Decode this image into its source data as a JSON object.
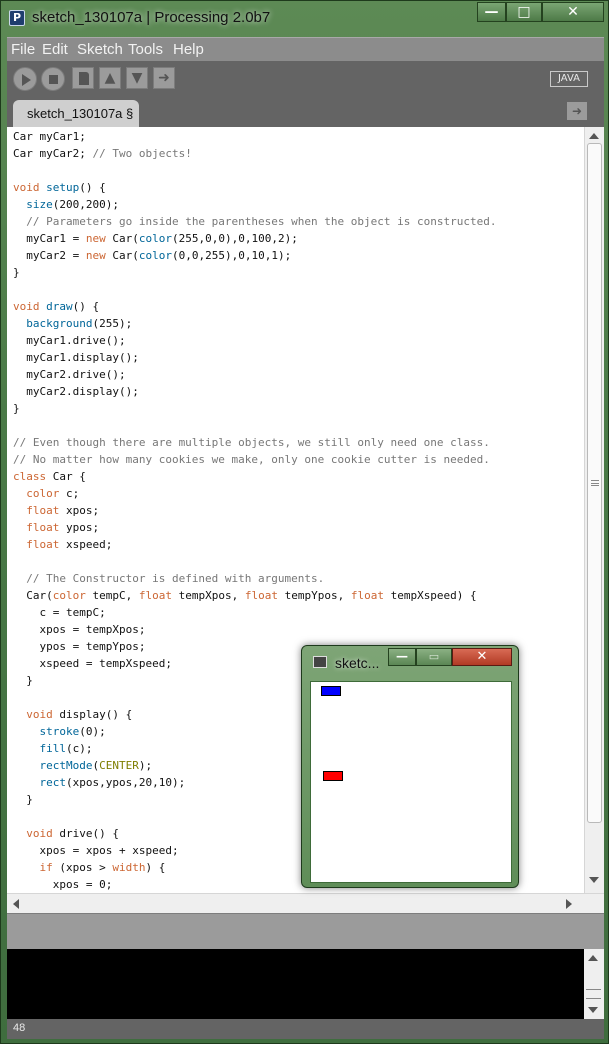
{
  "window": {
    "title": "sketch_130107a | Processing 2.0b7",
    "icon_letter": "P",
    "controls": {
      "minimize": "—",
      "maximize": "□",
      "close": "✕"
    }
  },
  "menu": {
    "items": [
      "File",
      "Edit",
      "Sketch",
      "Tools",
      "Help"
    ]
  },
  "toolbar": {
    "buttons": [
      "run-icon",
      "stop-icon",
      "new-icon",
      "open-icon",
      "save-icon",
      "export-icon"
    ],
    "mode": "JAVA"
  },
  "tabs": [
    {
      "label": "sketch_130107a §"
    }
  ],
  "tab_menu_icon": "arrow-right-icon",
  "code": {
    "lines": [
      [
        [
          "",
          "Car myCar1;"
        ]
      ],
      [
        [
          "",
          "Car myCar2; "
        ],
        [
          "cm",
          "// Two objects!"
        ]
      ],
      [
        [
          "",
          ""
        ]
      ],
      [
        [
          "kw",
          "void"
        ],
        [
          "",
          " "
        ],
        [
          "fn",
          "setup"
        ],
        [
          "",
          "() {"
        ]
      ],
      [
        [
          "",
          "  "
        ],
        [
          "fn",
          "size"
        ],
        [
          "",
          "(200,200);"
        ]
      ],
      [
        [
          "",
          "  "
        ],
        [
          "cm",
          "// Parameters go inside the parentheses when the object is constructed."
        ]
      ],
      [
        [
          "",
          "  myCar1 = "
        ],
        [
          "kw",
          "new"
        ],
        [
          "",
          " Car("
        ],
        [
          "fn",
          "color"
        ],
        [
          "",
          "(255,0,0),0,100,2);"
        ]
      ],
      [
        [
          "",
          "  myCar2 = "
        ],
        [
          "kw",
          "new"
        ],
        [
          "",
          " Car("
        ],
        [
          "fn",
          "color"
        ],
        [
          "",
          "(0,0,255),0,10,1);"
        ]
      ],
      [
        [
          "",
          "}"
        ]
      ],
      [
        [
          "",
          ""
        ]
      ],
      [
        [
          "kw",
          "void"
        ],
        [
          "",
          " "
        ],
        [
          "fn",
          "draw"
        ],
        [
          "",
          "() {"
        ]
      ],
      [
        [
          "",
          "  "
        ],
        [
          "fn",
          "background"
        ],
        [
          "",
          "(255);"
        ]
      ],
      [
        [
          "",
          "  myCar1.drive();"
        ]
      ],
      [
        [
          "",
          "  myCar1.display();"
        ]
      ],
      [
        [
          "",
          "  myCar2.drive();"
        ]
      ],
      [
        [
          "",
          "  myCar2.display();"
        ]
      ],
      [
        [
          "",
          "}"
        ]
      ],
      [
        [
          "",
          ""
        ]
      ],
      [
        [
          "cm",
          "// Even though there are multiple objects, we still only need one class."
        ]
      ],
      [
        [
          "cm",
          "// No matter how many cookies we make, only one cookie cutter is needed."
        ]
      ],
      [
        [
          "kw",
          "class"
        ],
        [
          "",
          " Car {"
        ]
      ],
      [
        [
          "",
          "  "
        ],
        [
          "kw",
          "color"
        ],
        [
          "",
          " c;"
        ]
      ],
      [
        [
          "",
          "  "
        ],
        [
          "kw",
          "float"
        ],
        [
          "",
          " xpos;"
        ]
      ],
      [
        [
          "",
          "  "
        ],
        [
          "kw",
          "float"
        ],
        [
          "",
          " ypos;"
        ]
      ],
      [
        [
          "",
          "  "
        ],
        [
          "kw",
          "float"
        ],
        [
          "",
          " xspeed;"
        ]
      ],
      [
        [
          "",
          ""
        ]
      ],
      [
        [
          "",
          "  "
        ],
        [
          "cm",
          "// The Constructor is defined with arguments."
        ]
      ],
      [
        [
          "",
          "  Car("
        ],
        [
          "kw",
          "color"
        ],
        [
          "",
          " tempC, "
        ],
        [
          "kw",
          "float"
        ],
        [
          "",
          " tempXpos, "
        ],
        [
          "kw",
          "float"
        ],
        [
          "",
          " tempYpos, "
        ],
        [
          "kw",
          "float"
        ],
        [
          "",
          " tempXspeed) {"
        ]
      ],
      [
        [
          "",
          "    c = tempC;"
        ]
      ],
      [
        [
          "",
          "    xpos = tempXpos;"
        ]
      ],
      [
        [
          "",
          "    ypos = tempYpos;"
        ]
      ],
      [
        [
          "",
          "    xspeed = tempXspeed;"
        ]
      ],
      [
        [
          "",
          "  }"
        ]
      ],
      [
        [
          "",
          ""
        ]
      ],
      [
        [
          "",
          "  "
        ],
        [
          "kw",
          "void"
        ],
        [
          "",
          " display() {"
        ]
      ],
      [
        [
          "",
          "    "
        ],
        [
          "fn",
          "stroke"
        ],
        [
          "",
          "(0);"
        ]
      ],
      [
        [
          "",
          "    "
        ],
        [
          "fn",
          "fill"
        ],
        [
          "",
          "(c);"
        ]
      ],
      [
        [
          "",
          "    "
        ],
        [
          "fn",
          "rectMode"
        ],
        [
          "",
          "("
        ],
        [
          "co",
          "CENTER"
        ],
        [
          "",
          ");"
        ]
      ],
      [
        [
          "",
          "    "
        ],
        [
          "fn",
          "rect"
        ],
        [
          "",
          "(xpos,ypos,20,10);"
        ]
      ],
      [
        [
          "",
          "  }"
        ]
      ],
      [
        [
          "",
          ""
        ]
      ],
      [
        [
          "",
          "  "
        ],
        [
          "kw",
          "void"
        ],
        [
          "",
          " drive() {"
        ]
      ],
      [
        [
          "",
          "    xpos = xpos + xspeed;"
        ]
      ],
      [
        [
          "",
          "    "
        ],
        [
          "kw",
          "if"
        ],
        [
          "",
          " (xpos > "
        ],
        [
          "kw",
          "width"
        ],
        [
          "",
          ") {"
        ]
      ],
      [
        [
          "",
          "      xpos = 0;"
        ]
      ]
    ]
  },
  "status": {
    "line_number": "48"
  },
  "sketch_window": {
    "title": "sketc...",
    "controls": {
      "minimize": "—",
      "maximize": "▭",
      "close": "✕"
    },
    "cars": [
      {
        "color": "#0000ff"
      },
      {
        "color": "#ff0000"
      }
    ]
  },
  "colors": {
    "keyword": "#cc6633",
    "function": "#006699",
    "comment": "#777777",
    "constant": "#7e7e00"
  }
}
